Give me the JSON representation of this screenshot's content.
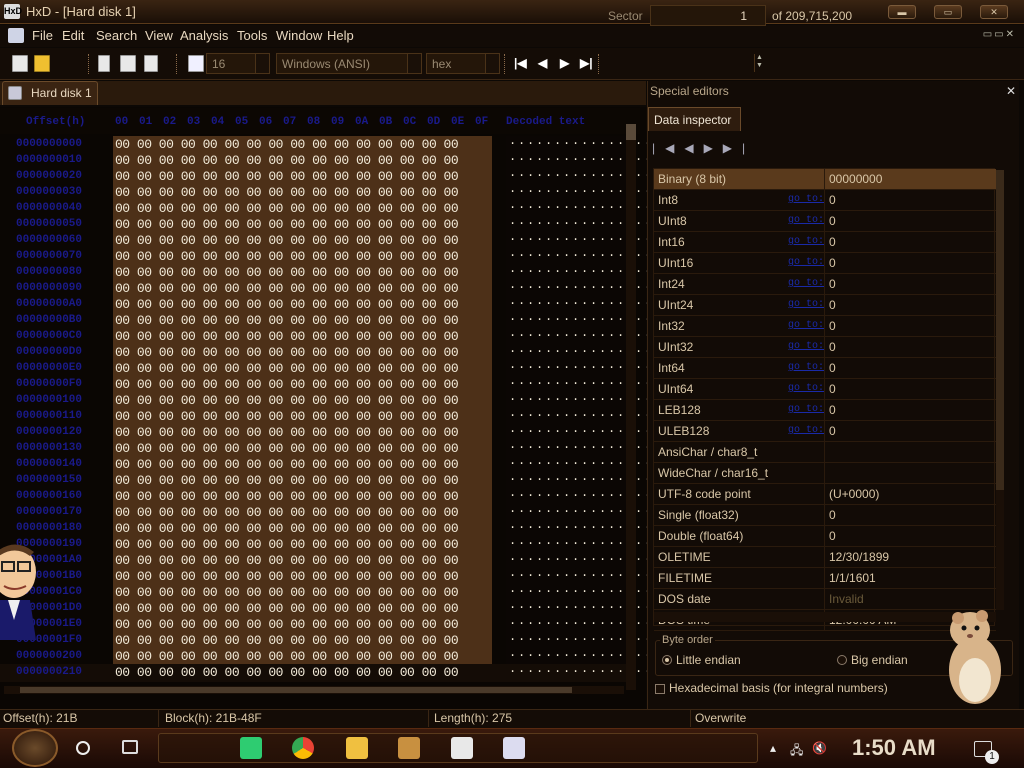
{
  "window": {
    "app_icon_text": "HxD",
    "title": "HxD - [Hard disk 1]"
  },
  "menu": [
    "File",
    "Edit",
    "Search",
    "View",
    "Analysis",
    "Tools",
    "Window",
    "Help"
  ],
  "toolbar": {
    "bytes_per_row": "16",
    "charset": "Windows (ANSI)",
    "offset_base": "hex",
    "sector_label": "Sector",
    "sector_value": "1",
    "sector_total": "of 209,715,200"
  },
  "tab": {
    "label": "Hard disk 1"
  },
  "hex": {
    "header_offset": "Offset(h)",
    "header_columns": [
      "00",
      "01",
      "02",
      "03",
      "04",
      "05",
      "06",
      "07",
      "08",
      "09",
      "0A",
      "0B",
      "0C",
      "0D",
      "0E",
      "0F"
    ],
    "header_text": "Decoded text",
    "rows": [
      {
        "offset": "0000000000",
        "bytes": "00 00 00 00 00 00 00 00 00 00 00 00 00 00 00 00",
        "text": "................"
      },
      {
        "offset": "0000000010",
        "bytes": "00 00 00 00 00 00 00 00 00 00 00 00 00 00 00 00",
        "text": "................"
      },
      {
        "offset": "0000000020",
        "bytes": "00 00 00 00 00 00 00 00 00 00 00 00 00 00 00 00",
        "text": "................"
      },
      {
        "offset": "0000000030",
        "bytes": "00 00 00 00 00 00 00 00 00 00 00 00 00 00 00 00",
        "text": "................"
      },
      {
        "offset": "0000000040",
        "bytes": "00 00 00 00 00 00 00 00 00 00 00 00 00 00 00 00",
        "text": "................"
      },
      {
        "offset": "0000000050",
        "bytes": "00 00 00 00 00 00 00 00 00 00 00 00 00 00 00 00",
        "text": "................"
      },
      {
        "offset": "0000000060",
        "bytes": "00 00 00 00 00 00 00 00 00 00 00 00 00 00 00 00",
        "text": "................"
      },
      {
        "offset": "0000000070",
        "bytes": "00 00 00 00 00 00 00 00 00 00 00 00 00 00 00 00",
        "text": "................"
      },
      {
        "offset": "0000000080",
        "bytes": "00 00 00 00 00 00 00 00 00 00 00 00 00 00 00 00",
        "text": "................"
      },
      {
        "offset": "0000000090",
        "bytes": "00 00 00 00 00 00 00 00 00 00 00 00 00 00 00 00",
        "text": "................"
      },
      {
        "offset": "00000000A0",
        "bytes": "00 00 00 00 00 00 00 00 00 00 00 00 00 00 00 00",
        "text": "................"
      },
      {
        "offset": "00000000B0",
        "bytes": "00 00 00 00 00 00 00 00 00 00 00 00 00 00 00 00",
        "text": "................"
      },
      {
        "offset": "00000000C0",
        "bytes": "00 00 00 00 00 00 00 00 00 00 00 00 00 00 00 00",
        "text": "................"
      },
      {
        "offset": "00000000D0",
        "bytes": "00 00 00 00 00 00 00 00 00 00 00 00 00 00 00 00",
        "text": "................"
      },
      {
        "offset": "00000000E0",
        "bytes": "00 00 00 00 00 00 00 00 00 00 00 00 00 00 00 00",
        "text": "................"
      },
      {
        "offset": "00000000F0",
        "bytes": "00 00 00 00 00 00 00 00 00 00 00 00 00 00 00 00",
        "text": "................"
      },
      {
        "offset": "0000000100",
        "bytes": "00 00 00 00 00 00 00 00 00 00 00 00 00 00 00 00",
        "text": "................"
      },
      {
        "offset": "0000000110",
        "bytes": "00 00 00 00 00 00 00 00 00 00 00 00 00 00 00 00",
        "text": "................"
      },
      {
        "offset": "0000000120",
        "bytes": "00 00 00 00 00 00 00 00 00 00 00 00 00 00 00 00",
        "text": "................"
      },
      {
        "offset": "0000000130",
        "bytes": "00 00 00 00 00 00 00 00 00 00 00 00 00 00 00 00",
        "text": "................"
      },
      {
        "offset": "0000000140",
        "bytes": "00 00 00 00 00 00 00 00 00 00 00 00 00 00 00 00",
        "text": "................"
      },
      {
        "offset": "0000000150",
        "bytes": "00 00 00 00 00 00 00 00 00 00 00 00 00 00 00 00",
        "text": "................"
      },
      {
        "offset": "0000000160",
        "bytes": "00 00 00 00 00 00 00 00 00 00 00 00 00 00 00 00",
        "text": "................"
      },
      {
        "offset": "0000000170",
        "bytes": "00 00 00 00 00 00 00 00 00 00 00 00 00 00 00 00",
        "text": "................"
      },
      {
        "offset": "0000000180",
        "bytes": "00 00 00 00 00 00 00 00 00 00 00 00 00 00 00 00",
        "text": "................"
      },
      {
        "offset": "0000000190",
        "bytes": "00 00 00 00 00 00 00 00 00 00 00 00 00 00 00 00",
        "text": "................"
      },
      {
        "offset": "00000001A0",
        "bytes": "00 00 00 00 00 00 00 00 00 00 00 00 00 00 00 00",
        "text": "................"
      },
      {
        "offset": "00000001B0",
        "bytes": "00 00 00 00 00 00 00 00 00 00 00 00 00 00 00 00",
        "text": "................"
      },
      {
        "offset": "00000001C0",
        "bytes": "00 00 00 00 00 00 00 00 00 00 00 00 00 00 00 00",
        "text": "................"
      },
      {
        "offset": "00000001D0",
        "bytes": "00 00 00 00 00 00 00 00 00 00 00 00 00 00 00 00",
        "text": "................"
      },
      {
        "offset": "00000001E0",
        "bytes": "00 00 00 00 00 00 00 00 00 00 00 00 00 00 00 00",
        "text": "................"
      },
      {
        "offset": "00000001F0",
        "bytes": "00 00 00 00 00 00 00 00 00 00 00 00 00 00 00 00",
        "text": "................"
      },
      {
        "offset": "0000000200",
        "bytes": "00 00 00 00 00 00 00 00 00 00 00 00 00 00 00 00",
        "text": "................"
      },
      {
        "offset": "0000000210",
        "bytes": "00 00 00 00 00 00 00 00 00 00 00 00 00 00 00 00",
        "text": "................"
      }
    ]
  },
  "special_editors": {
    "title": "Special editors",
    "tab": "Data inspector",
    "rows": [
      {
        "name": "Binary (8 bit)",
        "goto": "",
        "value": "00000000",
        "selected": true
      },
      {
        "name": "Int8",
        "goto": "go to:",
        "value": "0"
      },
      {
        "name": "UInt8",
        "goto": "go to:",
        "value": "0"
      },
      {
        "name": "Int16",
        "goto": "go to:",
        "value": "0"
      },
      {
        "name": "UInt16",
        "goto": "go to:",
        "value": "0"
      },
      {
        "name": "Int24",
        "goto": "go to:",
        "value": "0"
      },
      {
        "name": "UInt24",
        "goto": "go to:",
        "value": "0"
      },
      {
        "name": "Int32",
        "goto": "go to:",
        "value": "0"
      },
      {
        "name": "UInt32",
        "goto": "go to:",
        "value": "0"
      },
      {
        "name": "Int64",
        "goto": "go to:",
        "value": "0"
      },
      {
        "name": "UInt64",
        "goto": "go to:",
        "value": "0"
      },
      {
        "name": "LEB128",
        "goto": "go to:",
        "value": "0"
      },
      {
        "name": "ULEB128",
        "goto": "go to:",
        "value": "0"
      },
      {
        "name": "AnsiChar / char8_t",
        "goto": "",
        "value": ""
      },
      {
        "name": "WideChar / char16_t",
        "goto": "",
        "value": ""
      },
      {
        "name": "UTF-8 code point",
        "goto": "",
        "value": "   (U+0000)"
      },
      {
        "name": "Single (float32)",
        "goto": "",
        "value": "0"
      },
      {
        "name": "Double (float64)",
        "goto": "",
        "value": "0"
      },
      {
        "name": "OLETIME",
        "goto": "",
        "value": "12/30/1899"
      },
      {
        "name": "FILETIME",
        "goto": "",
        "value": "1/1/1601"
      },
      {
        "name": "DOS date",
        "goto": "",
        "value": "Invalid",
        "dim": true
      },
      {
        "name": "DOS time",
        "goto": "",
        "value": "12:00:00 AM"
      }
    ],
    "byte_order_label": "Byte order",
    "little_endian": "Little endian",
    "big_endian": "Big endian",
    "hex_basis": "Hexadecimal basis (for integral numbers)"
  },
  "status": {
    "offset": "Offset(h): 21B",
    "block": "Block(h): 21B-48F",
    "length": "Length(h): 275",
    "mode": "Overwrite"
  },
  "taskbar": {
    "clock": "1:50 AM",
    "notif_count": "1"
  },
  "colors": {
    "accent": "#5a3a1c",
    "hex_bg": "#4d3018",
    "offset_text": "#1a1a8a"
  }
}
